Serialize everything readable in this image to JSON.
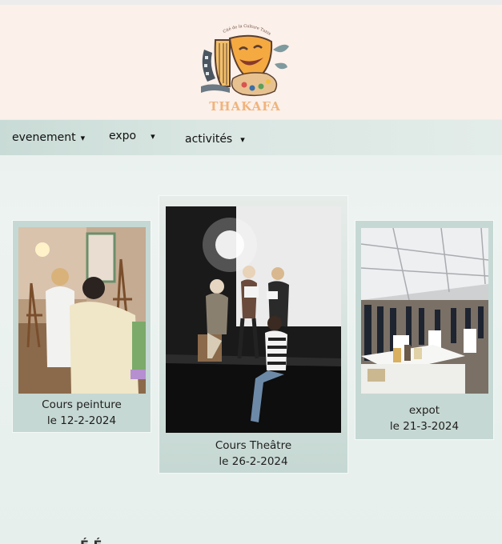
{
  "header": {
    "logo_tagline": "Cité de la Culture Tunis",
    "logo_word": "THAKAFA"
  },
  "nav": {
    "items": [
      {
        "label": "evenement",
        "arrow": "▾"
      },
      {
        "label": "expo",
        "arrow": "▾"
      },
      {
        "label": "activités",
        "arrow": "▾"
      }
    ]
  },
  "cards": [
    {
      "title": "Cours peinture",
      "date": "le 12-2-2024"
    },
    {
      "title": "Cours Theâtre",
      "date": "le 26-2-2024"
    },
    {
      "title": "expot",
      "date": "le 21-3-2024"
    }
  ],
  "bottom": {
    "partial": "É      É"
  }
}
